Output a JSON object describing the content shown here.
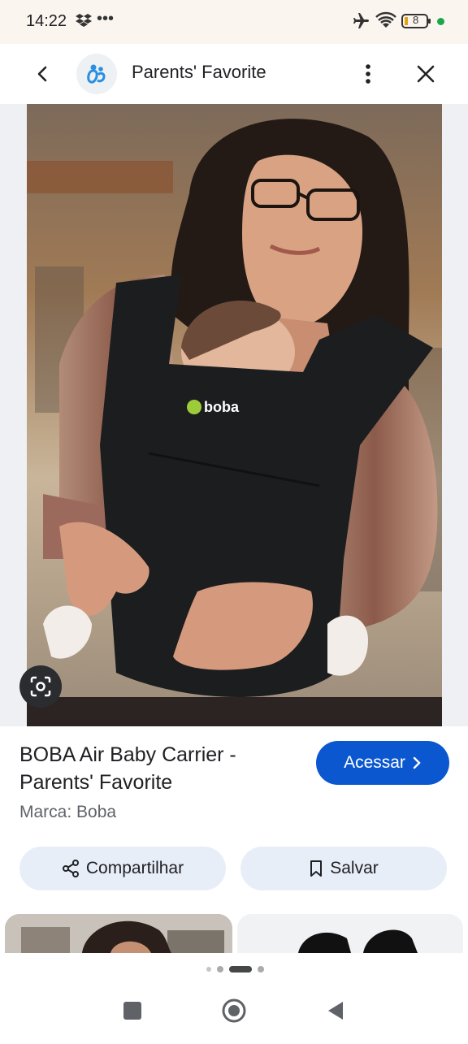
{
  "status_bar": {
    "time": "14:22",
    "left_icons": [
      "dropbox-icon",
      "more-dots-icon"
    ],
    "right_icons": [
      "airplane-mode-icon",
      "wifi-icon",
      "battery-icon",
      "dot-indicator"
    ],
    "battery_level": "8",
    "dot_color": "#1aa84d"
  },
  "header": {
    "title": "Parents' Favorite",
    "back_icon": "back-arrow-icon",
    "menu_icon": "vertical-dots-icon",
    "close_icon": "close-icon"
  },
  "image": {
    "brand_print": "boba",
    "lens_icon": "lens-icon"
  },
  "product": {
    "title": "BOBA Air Baby Carrier - Parents' Favorite",
    "brand_line": "Marca: Boba",
    "visit_label": "Acessar",
    "share_label": "Compartilhar",
    "save_label": "Salvar"
  },
  "colors": {
    "accent": "#0b57d0",
    "pill_bg": "#e8eef8",
    "status_bg": "#fbf5ef"
  },
  "pager": {
    "count": 4,
    "active": 2
  },
  "nav": {
    "icons": [
      "recents-square-icon",
      "home-circle-icon",
      "back-triangle-icon"
    ]
  }
}
